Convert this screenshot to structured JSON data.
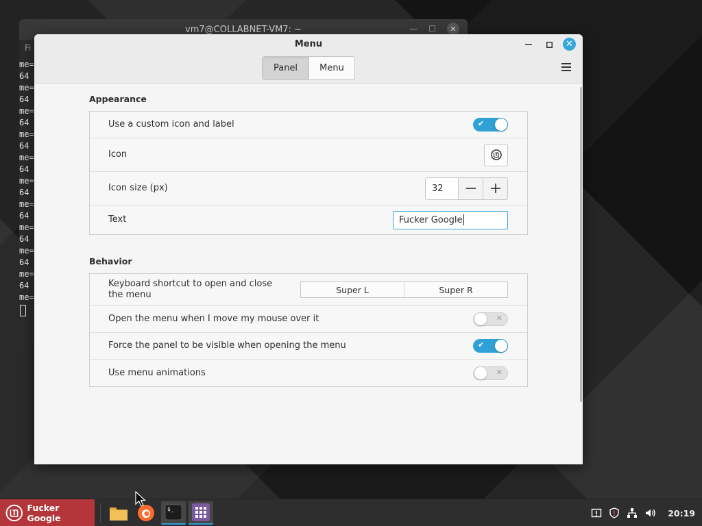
{
  "terminal": {
    "title": "vm7@COLLABNET-VM7: ~",
    "menu_fragment": "Fi",
    "lines": [
      "me=",
      "64",
      "me=",
      "64",
      "me=",
      "64",
      "me=",
      "64",
      "me=",
      "64",
      "me=",
      "64",
      "me=",
      "64",
      "me=",
      "64",
      "me=",
      "64",
      "me=",
      "64",
      "me="
    ]
  },
  "dialog": {
    "title": "Menu",
    "tabs": [
      {
        "label": "Panel",
        "active": true
      },
      {
        "label": "Menu",
        "active": false
      }
    ],
    "appearance": {
      "title": "Appearance",
      "custom_icon_label": "Use a custom icon and label",
      "custom_icon_enabled": true,
      "icon_label": "Icon",
      "icon_size_label": "Icon size (px)",
      "icon_size_value": "32",
      "text_label": "Text",
      "text_value": "Fucker Google"
    },
    "behavior": {
      "title": "Behavior",
      "shortcut_label": "Keyboard shortcut to open and close the menu",
      "shortcut_primary": "Super L",
      "shortcut_secondary": "Super R",
      "hover_label": "Open the menu when I move my mouse over it",
      "hover_enabled": false,
      "force_panel_label": "Force the panel to be visible when opening the menu",
      "force_panel_enabled": true,
      "animations_label": "Use menu animations",
      "animations_enabled": false
    }
  },
  "taskbar": {
    "menu_label": "Fucker Google",
    "clock": "20:19",
    "accent_color": "#2fa1d6",
    "menu_color": "#b4363a"
  }
}
